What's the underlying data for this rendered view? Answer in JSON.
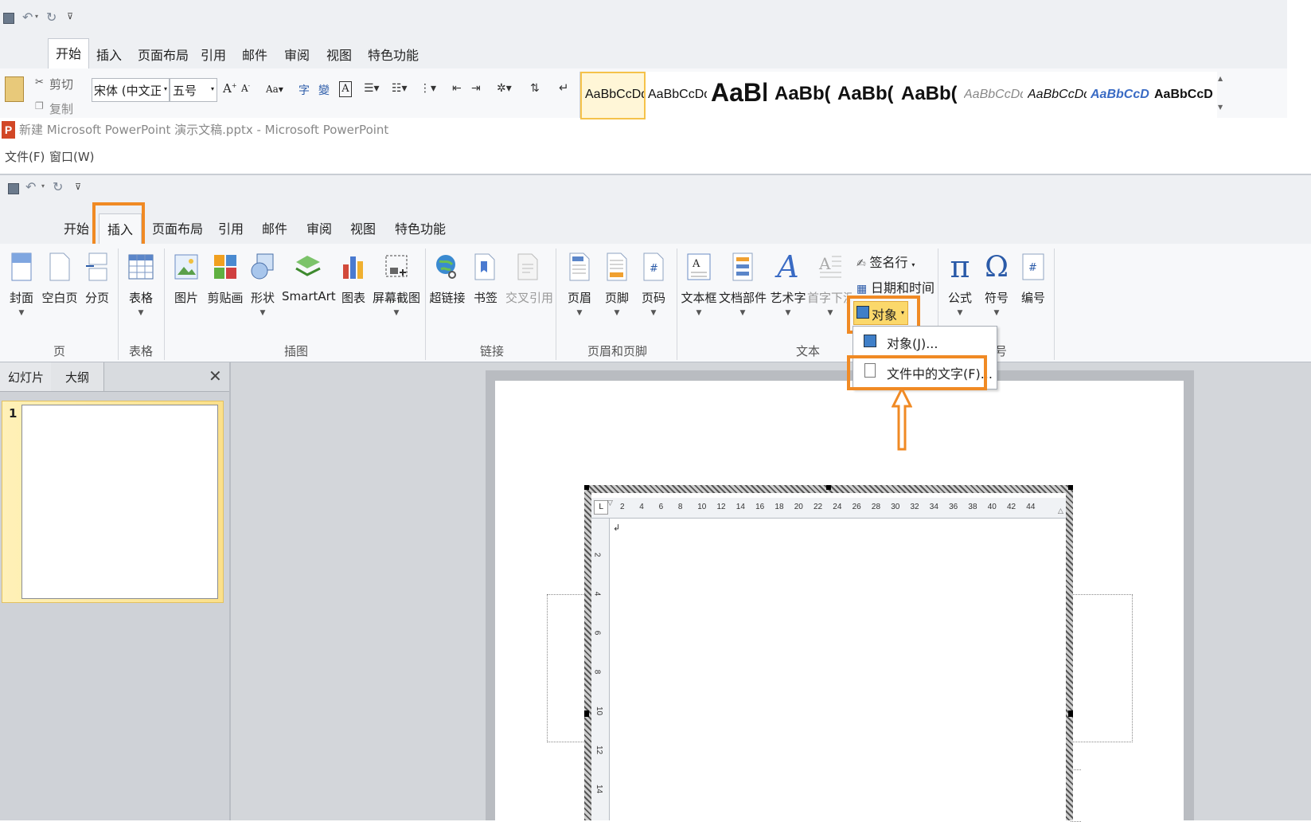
{
  "background_word": {
    "tabs": [
      "开始",
      "插入",
      "页面布局",
      "引用",
      "邮件",
      "审阅",
      "视图",
      "特色功能"
    ],
    "clipboard": {
      "cut": "剪切",
      "copy": "复制"
    },
    "font_name": "宋体 (中文正:",
    "font_size": "五号",
    "styles": [
      "AaBbCcDd",
      "AaBbCcDd",
      "AaBb",
      "AaBb(",
      "AaBb(",
      "AaBb(",
      "AaBbCcDd",
      "AaBbCcDd",
      "AaBbCcDc",
      "AaBbCcDc"
    ]
  },
  "window": {
    "title": "新建 Microsoft PowerPoint 演示文稿.pptx - Microsoft PowerPoint",
    "menu": [
      "文件(F)",
      "窗口(W)"
    ]
  },
  "ribbon": {
    "tabs": [
      "开始",
      "插入",
      "页面布局",
      "引用",
      "邮件",
      "审阅",
      "视图",
      "特色功能"
    ],
    "active_tab": "插入",
    "buttons": {
      "cover": "封面",
      "blank_page": "空白页",
      "page_break": "分页",
      "table": "表格",
      "picture": "图片",
      "clip_art": "剪贴画",
      "shapes": "形状",
      "smartart": "SmartArt",
      "chart": "图表",
      "screenshot": "屏幕截图",
      "hyperlink": "超链接",
      "bookmark": "书签",
      "cross_ref": "交叉引用",
      "header": "页眉",
      "footer": "页脚",
      "page_number": "页码",
      "textbox": "文本框",
      "quick_parts": "文档部件",
      "wordart": "艺术字",
      "drop_cap": "首字下沉",
      "signature_line": "签名行",
      "date_time": "日期和时间",
      "object": "对象",
      "equation": "公式",
      "symbol": "符号",
      "numbering": "编号"
    },
    "groups": {
      "pages": "页",
      "tables": "表格",
      "illustrations": "插图",
      "links": "链接",
      "header_footer": "页眉和页脚",
      "text": "文本",
      "symbols": "号"
    }
  },
  "object_menu": {
    "items": [
      "对象(J)...",
      "文件中的文字(F)..."
    ]
  },
  "left_pane": {
    "tabs": [
      "幻灯片",
      "大纲"
    ],
    "slide_number": "1"
  },
  "ruler": {
    "marks": [
      "2",
      "4",
      "6",
      "8",
      "10",
      "12",
      "14",
      "16",
      "18",
      "20",
      "22",
      "24",
      "26",
      "28",
      "30",
      "32",
      "34",
      "36",
      "38",
      "40",
      "42",
      "44"
    ],
    "vmarks": [
      "2",
      "4",
      "6",
      "8",
      "10",
      "12",
      "14"
    ]
  },
  "colors": {
    "highlight": "#f08a24",
    "ribbon_bg": "#f7f8fa",
    "active_yellow": "#fbd86b"
  }
}
